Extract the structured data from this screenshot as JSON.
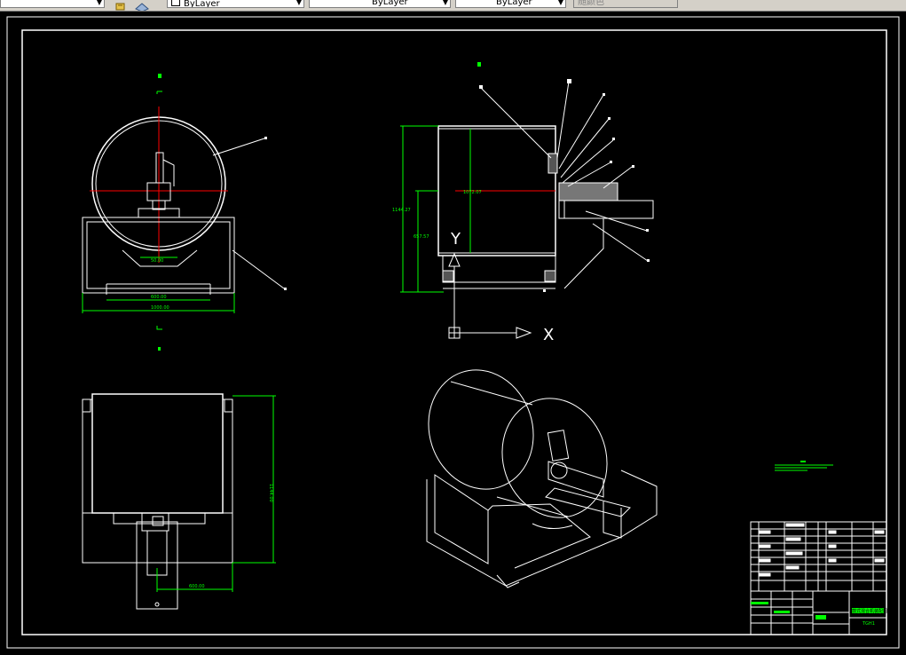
{
  "toolbar": {
    "first_combo_value": "",
    "color_value": "ByLayer",
    "linetype_value": "ByLayer",
    "lineweight_value": "ByLayer",
    "plotstyle_value": "随颜色"
  },
  "drawing": {
    "front_view": {
      "top_label": "B",
      "arc_dim": "50.00",
      "base_dim": "600.00",
      "overall_dim": "1000.00"
    },
    "side_view": {
      "top_label": "B",
      "height_dim": "1144.27",
      "inner_dim": "657.57",
      "width_dim": "1072.07",
      "ucs_y": "Y",
      "ucs_x": "X"
    },
    "plan_view": {
      "height_dim": "1144.00",
      "offset_dim": "600.00"
    },
    "title_block": {
      "title": "鼓式混合机装配图",
      "drawing_no": "TGH1"
    }
  },
  "colors": {
    "background": "#000000",
    "geometry": "#ffffff",
    "dimension": "#00ff00",
    "centerline": "#ff0000",
    "toolbar": "#d4d0c8"
  }
}
